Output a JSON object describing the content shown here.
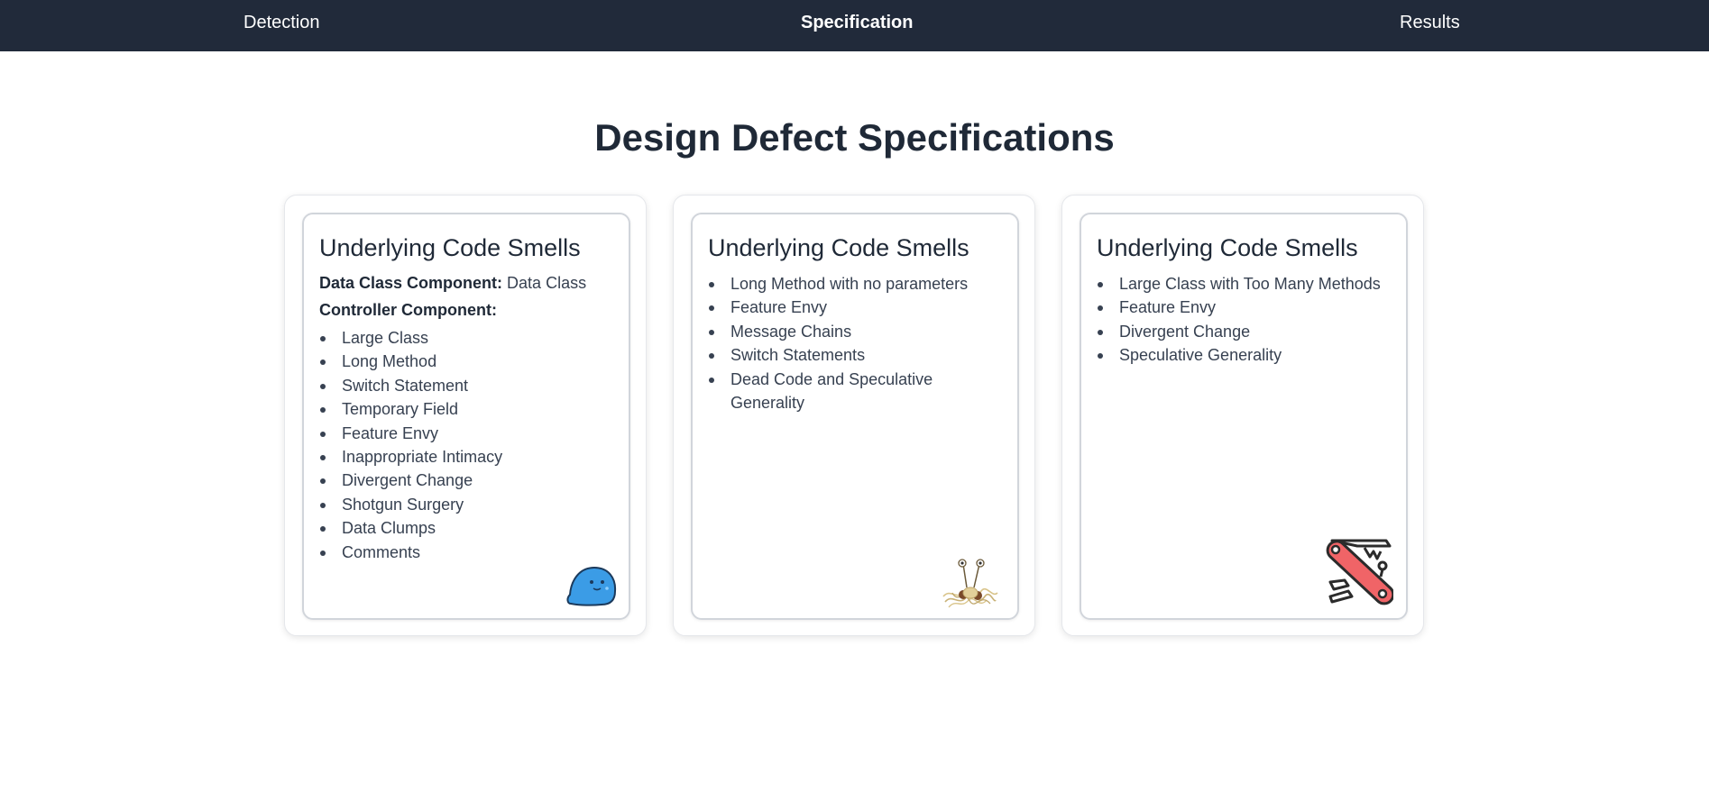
{
  "nav": {
    "items": [
      {
        "label": "Detection"
      },
      {
        "label": "Specification"
      },
      {
        "label": "Results"
      }
    ]
  },
  "page": {
    "title": "Design Defect Specifications"
  },
  "cards": [
    {
      "title": "Underlying Code Smells",
      "data_class_label": "Data Class Component:",
      "data_class_value": "Data Class",
      "controller_label": "Controller Component:",
      "items": [
        "Large Class",
        "Long Method",
        "Switch Statement",
        "Temporary Field",
        "Feature Envy",
        "Inappropriate Intimacy",
        "Divergent Change",
        "Shotgun Surgery",
        "Data Clumps",
        "Comments"
      ],
      "icon": "blob-icon"
    },
    {
      "title": "Underlying Code Smells",
      "items": [
        "Long Method with no parameters",
        "Feature Envy",
        "Message Chains",
        "Switch Statements",
        "Dead Code and Speculative Generality"
      ],
      "icon": "spaghetti-monster-icon"
    },
    {
      "title": "Underlying Code Smells",
      "items": [
        "Large Class with Too Many Methods",
        "Feature Envy",
        "Divergent Change",
        "Speculative Generality"
      ],
      "icon": "swiss-army-knife-icon"
    }
  ],
  "colors": {
    "nav_bg": "#212a3a",
    "text": "#1f2937",
    "blob": "#3b9ce6",
    "knife": "#f06467"
  }
}
